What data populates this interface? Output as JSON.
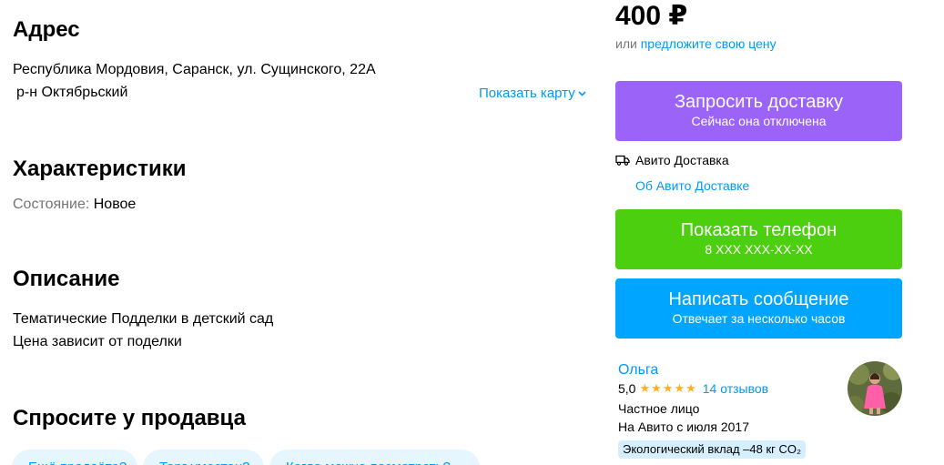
{
  "address": {
    "title": "Адрес",
    "line1": "Республика Мордовия, Саранск, ул. Сущинского, 22А",
    "district": "р-н Октябрьский",
    "show_map": "Показать карту"
  },
  "characteristics": {
    "title": "Характеристики",
    "condition_label": "Состояние:",
    "condition_value": "Новое"
  },
  "description": {
    "title": "Описание",
    "lines": [
      "Тематические Подделки в детский сад",
      "Цена зависит от поделки"
    ]
  },
  "ask_seller": {
    "title": "Спросите у продавца",
    "chips": [
      "Ещё продаёте?",
      "Торг уместен?",
      "Когда можно посмотреть?"
    ]
  },
  "price": {
    "value": "400 ₽",
    "or": "или",
    "offer": "предложите свою цену"
  },
  "delivery_button": {
    "label": "Запросить доставку",
    "sub": "Сейчас она отключена",
    "color": "#9b63f8"
  },
  "delivery": {
    "icon": "truck-icon",
    "label": "Авито Доставка",
    "about": "Об Авито Доставке"
  },
  "phone_button": {
    "label": "Показать телефон",
    "sub": "8 XXX XXX-XX-XX",
    "color": "#4ccf0e"
  },
  "message_button": {
    "label": "Написать сообщение",
    "sub": "Отвечает за несколько часов",
    "color": "#00a5ff"
  },
  "seller": {
    "name": "Ольга",
    "rating": "5,0",
    "stars": 5,
    "reviews": "14 отзывов",
    "type": "Частное лицо",
    "since": "На Авито с июля 2017",
    "eco": "Экологический вклад –48 кг CO₂"
  },
  "colors": {
    "link": "#0099f7",
    "star": "#ffb021",
    "chip_bg": "#e6f6ff",
    "eco_bg": "#d6efff"
  }
}
